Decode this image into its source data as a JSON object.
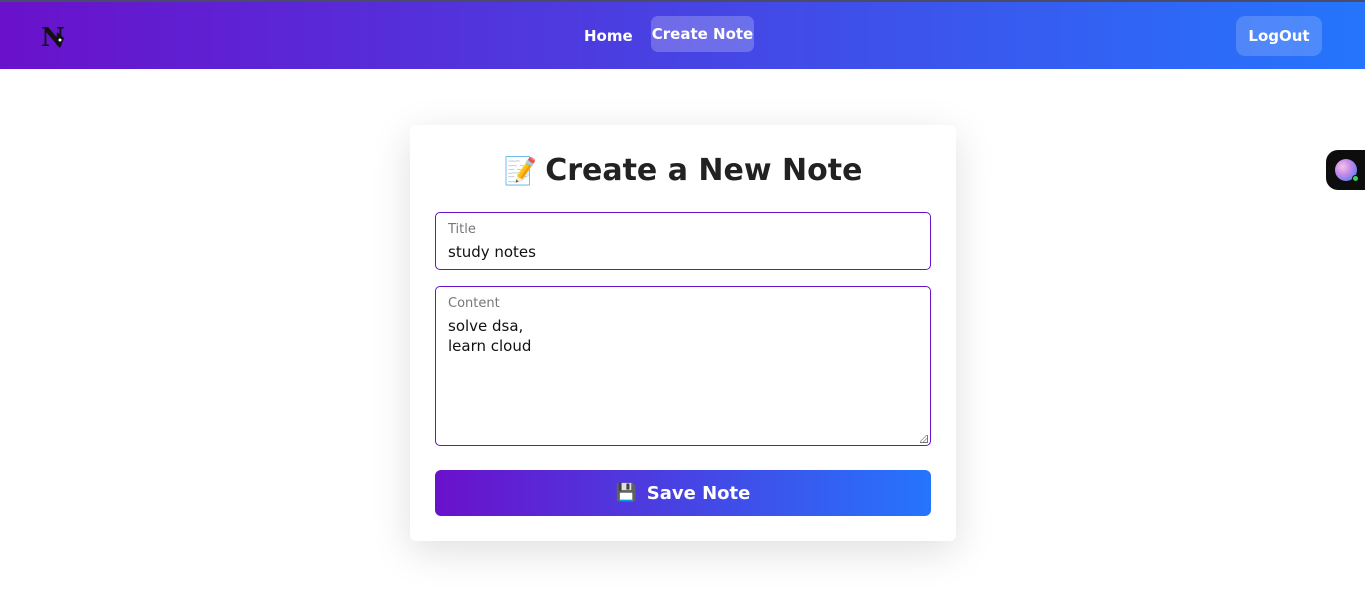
{
  "nav": {
    "logo_letter": "N",
    "home_label": "Home",
    "create_note_label": "Create Note",
    "logout_label": "LogOut"
  },
  "card": {
    "title_emoji": "📝",
    "title": "Create a New Note",
    "title_field": {
      "label": "Title",
      "value": "study notes"
    },
    "content_field": {
      "label": "Content",
      "lines": [
        "solve dsa,",
        "learn cloud"
      ]
    },
    "save_emoji": "💾",
    "save_label": "Save Note"
  },
  "colors": {
    "gradient_start": "#6a11cb",
    "gradient_end": "#2575fc",
    "field_border": "#6a11cb"
  },
  "icons": {
    "logo": "pen-nib-logo-icon",
    "side_widget": "assistant-orb-icon"
  }
}
